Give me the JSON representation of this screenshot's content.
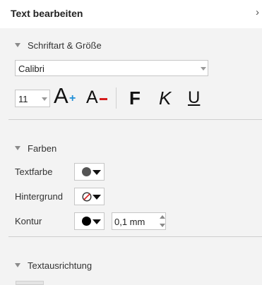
{
  "panel": {
    "title": "Text bearbeiten",
    "close_label": "›"
  },
  "font_section": {
    "label": "Schriftart & Größe",
    "font_name": "Calibri",
    "font_size": "11",
    "grow_font_glyph": "A",
    "grow_font_symbol": "+",
    "shrink_font_glyph": "A",
    "bold_glyph": "F",
    "italic_glyph": "K",
    "underline_glyph": "U"
  },
  "colors_section": {
    "label": "Farben",
    "text_color_label": "Textfarbe",
    "background_label": "Hintergrund",
    "outline_label": "Kontur",
    "outline_width": "0,1 mm"
  },
  "alignment_section": {
    "label": "Textausrichtung"
  },
  "colors": {
    "text_color": "#555555",
    "outline_color": "#000000",
    "accent_plus": "#1f8fd8",
    "accent_minus": "#d61c1c"
  }
}
